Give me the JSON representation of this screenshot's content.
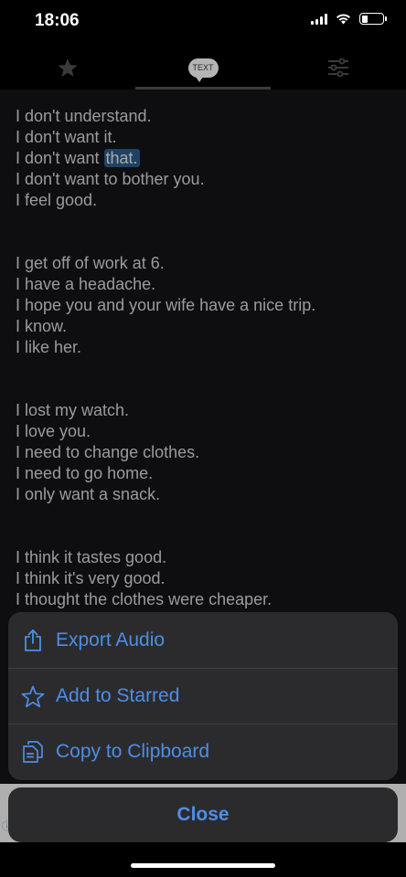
{
  "status_bar": {
    "time": "18:06",
    "battery_level": 0.3
  },
  "tabs": [
    {
      "name": "starred",
      "icon": "star-icon",
      "selected": false
    },
    {
      "name": "text",
      "icon": "text-bubble-icon",
      "label": "TEXT",
      "selected": true
    },
    {
      "name": "settings",
      "icon": "sliders-icon",
      "selected": false
    }
  ],
  "content": {
    "groups": [
      [
        {
          "text": "I don't understand."
        },
        {
          "text": "I don't want it."
        },
        {
          "text": "I don't want ",
          "highlight": "that."
        },
        {
          "text": "I don't want to bother you."
        },
        {
          "text": "I feel good."
        }
      ],
      [
        {
          "text": "I get off of work at 6."
        },
        {
          "text": "I have a headache."
        },
        {
          "text": "I hope you and your wife have a nice trip."
        },
        {
          "text": "I know."
        },
        {
          "text": "I like her."
        }
      ],
      [
        {
          "text": "I lost my watch."
        },
        {
          "text": "I love you."
        },
        {
          "text": "I need to change clothes."
        },
        {
          "text": "I need to go home."
        },
        {
          "text": "I only want a snack."
        }
      ],
      [
        {
          "text": "I think it tastes good."
        },
        {
          "text": "I think it's very good."
        },
        {
          "text": "I thought the clothes were cheaper."
        }
      ]
    ]
  },
  "action_sheet": {
    "export_label": "Export Audio",
    "starred_label": "Add to Starred",
    "clipboard_label": "Copy to Clipboard",
    "close_label": "Close"
  },
  "colors": {
    "accent": "#4d8ee6",
    "highlight": "#2b5c8a",
    "sheet_background": "#2b2b2e",
    "content_background": "#141417"
  }
}
